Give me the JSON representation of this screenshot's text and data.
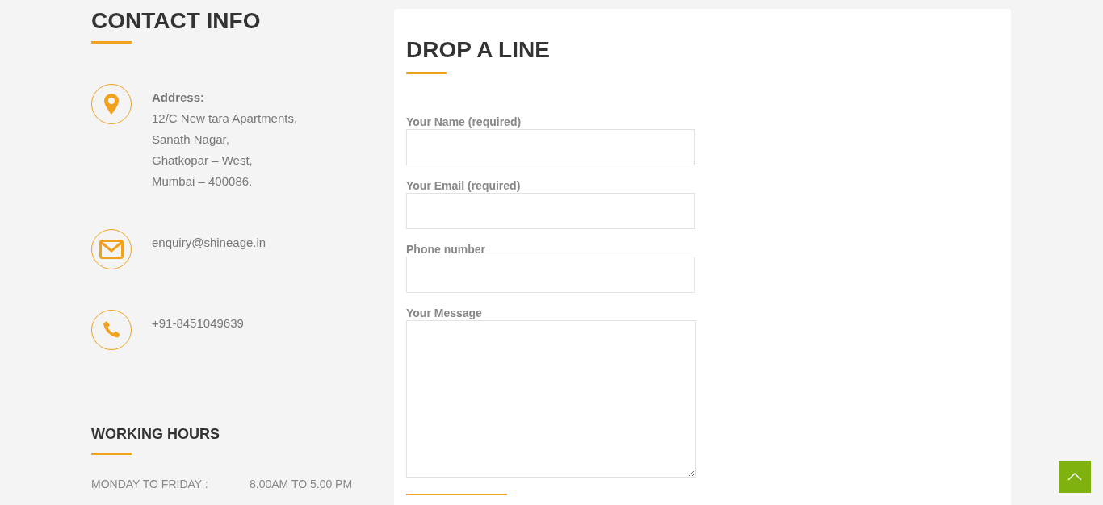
{
  "contact_info": {
    "title": "CONTACT INFO",
    "items": [
      {
        "kind": "address",
        "label": "Address:",
        "lines": [
          "12/C New tara Apartments,",
          "Sanath Nagar,",
          "Ghatkopar – West,",
          "Mumbai – 400086."
        ]
      },
      {
        "kind": "email",
        "lines": [
          "enquiry@shineage.in"
        ]
      },
      {
        "kind": "phone",
        "lines": [
          "+91-8451049639"
        ]
      }
    ]
  },
  "working_hours": {
    "title": "WORKING HOURS",
    "rows": [
      {
        "days": "MONDAY TO FRIDAY :",
        "hours": "8.00AM TO 5.00 PM"
      }
    ]
  },
  "form": {
    "title": "DROP A LINE",
    "fields": [
      {
        "kind": "text",
        "label": "Your Name (required)"
      },
      {
        "kind": "text",
        "label": "Your Email (required)"
      },
      {
        "kind": "text",
        "label": "Phone number"
      },
      {
        "kind": "textarea",
        "label": "Your Message"
      }
    ]
  }
}
